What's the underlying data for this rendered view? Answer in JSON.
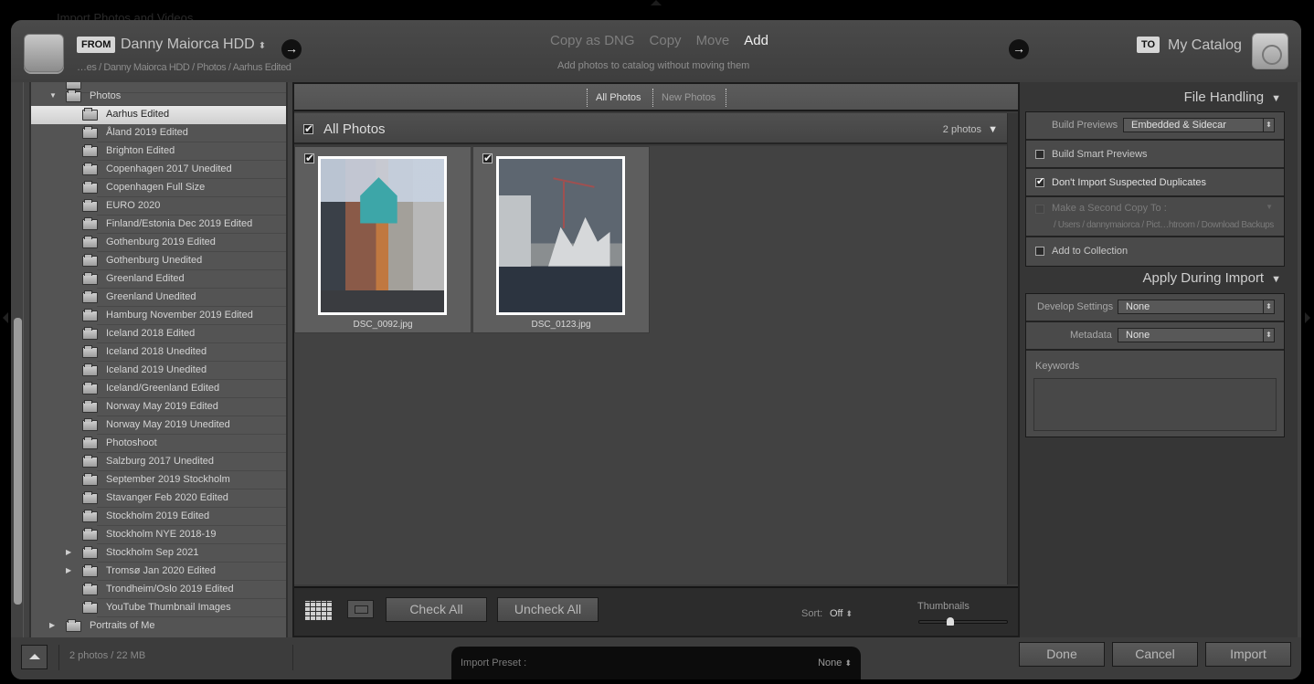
{
  "window": {
    "title": "Import Photos and Videos"
  },
  "header": {
    "from_badge": "FROM",
    "source_name": "Danny Maiorca HDD",
    "source_path": "…es / Danny Maiorca HDD / Photos / Aarhus Edited",
    "modes": [
      {
        "label": "Copy as DNG",
        "active": false
      },
      {
        "label": "Copy",
        "active": false
      },
      {
        "label": "Move",
        "active": false
      },
      {
        "label": "Add",
        "active": true
      }
    ],
    "mode_description": "Add photos to catalog without moving them",
    "to_badge": "TO",
    "destination_name": "My Catalog",
    "arrow_glyph": "→",
    "updown_glyph": "⬍"
  },
  "source_tree": {
    "parent": {
      "label": "Photos",
      "expanded": true
    },
    "folders": [
      {
        "label": "Aarhus Edited",
        "selected": true,
        "has_children": false
      },
      {
        "label": "Åland 2019 Edited",
        "selected": false,
        "has_children": false
      },
      {
        "label": "Brighton Edited",
        "selected": false,
        "has_children": false
      },
      {
        "label": "Copenhagen 2017 Unedited",
        "selected": false,
        "has_children": false
      },
      {
        "label": "Copenhagen Full Size",
        "selected": false,
        "has_children": false
      },
      {
        "label": "EURO 2020",
        "selected": false,
        "has_children": false
      },
      {
        "label": "Finland/Estonia Dec 2019 Edited",
        "selected": false,
        "has_children": false
      },
      {
        "label": "Gothenburg 2019 Edited",
        "selected": false,
        "has_children": false
      },
      {
        "label": "Gothenburg Unedited",
        "selected": false,
        "has_children": false
      },
      {
        "label": "Greenland Edited",
        "selected": false,
        "has_children": false
      },
      {
        "label": "Greenland Unedited",
        "selected": false,
        "has_children": false
      },
      {
        "label": "Hamburg November 2019 Edited",
        "selected": false,
        "has_children": false
      },
      {
        "label": "Iceland 2018 Edited",
        "selected": false,
        "has_children": false
      },
      {
        "label": "Iceland 2018 Unedited",
        "selected": false,
        "has_children": false
      },
      {
        "label": "Iceland 2019 Unedited",
        "selected": false,
        "has_children": false
      },
      {
        "label": "Iceland/Greenland Edited",
        "selected": false,
        "has_children": false
      },
      {
        "label": "Norway May 2019 Edited",
        "selected": false,
        "has_children": false
      },
      {
        "label": "Norway May 2019 Unedited",
        "selected": false,
        "has_children": false
      },
      {
        "label": "Photoshoot",
        "selected": false,
        "has_children": false
      },
      {
        "label": "Salzburg 2017 Unedited",
        "selected": false,
        "has_children": false
      },
      {
        "label": "September 2019 Stockholm",
        "selected": false,
        "has_children": false
      },
      {
        "label": "Stavanger Feb 2020 Edited",
        "selected": false,
        "has_children": false
      },
      {
        "label": "Stockholm 2019 Edited",
        "selected": false,
        "has_children": false
      },
      {
        "label": "Stockholm NYE 2018-19",
        "selected": false,
        "has_children": false
      },
      {
        "label": "Stockholm Sep 2021",
        "selected": false,
        "has_children": true
      },
      {
        "label": "Tromsø Jan 2020 Edited",
        "selected": false,
        "has_children": true
      },
      {
        "label": "Trondheim/Oslo 2019 Edited",
        "selected": false,
        "has_children": false
      },
      {
        "label": "YouTube Thumbnail Images",
        "selected": false,
        "has_children": false
      }
    ],
    "sibling": {
      "label": "Portraits of Me",
      "expanded": false
    }
  },
  "center": {
    "filter_tabs": [
      {
        "label": "All Photos",
        "active": true
      },
      {
        "label": "New Photos",
        "active": false
      }
    ],
    "grid_title": "All Photos",
    "grid_all_checked": true,
    "photo_count": "2 photos",
    "photos": [
      {
        "filename": "DSC_0092.jpg",
        "checked": true,
        "subject": "street with mural"
      },
      {
        "filename": "DSC_0123.jpg",
        "checked": true,
        "subject": "harbor buildings with cranes"
      }
    ],
    "check_all_label": "Check All",
    "uncheck_all_label": "Uncheck All",
    "sort_label": "Sort:",
    "sort_value": "Off",
    "thumbnails_label": "Thumbnails",
    "thumbnail_size_fraction": 0.35
  },
  "file_handling": {
    "title": "File Handling",
    "build_previews_label": "Build Previews",
    "build_previews_value": "Embedded & Sidecar",
    "build_smart_previews_label": "Build Smart Previews",
    "build_smart_previews_checked": false,
    "dont_import_duplicates_label": "Don't Import Suspected Duplicates",
    "dont_import_duplicates_checked": true,
    "second_copy_label": "Make a Second Copy To :",
    "second_copy_checked": false,
    "second_copy_path": "/ Users / dannymaiorca / Pict…htroom / Download Backups",
    "add_to_collection_label": "Add to Collection",
    "add_to_collection_checked": false
  },
  "apply_during_import": {
    "title": "Apply During Import",
    "develop_settings_label": "Develop Settings",
    "develop_settings_value": "None",
    "metadata_label": "Metadata",
    "metadata_value": "None",
    "keywords_label": "Keywords",
    "keywords_value": ""
  },
  "footer": {
    "summary": "2 photos / 22 MB",
    "import_preset_label": "Import Preset :",
    "import_preset_value": "None",
    "done_label": "Done",
    "cancel_label": "Cancel",
    "import_label": "Import"
  }
}
